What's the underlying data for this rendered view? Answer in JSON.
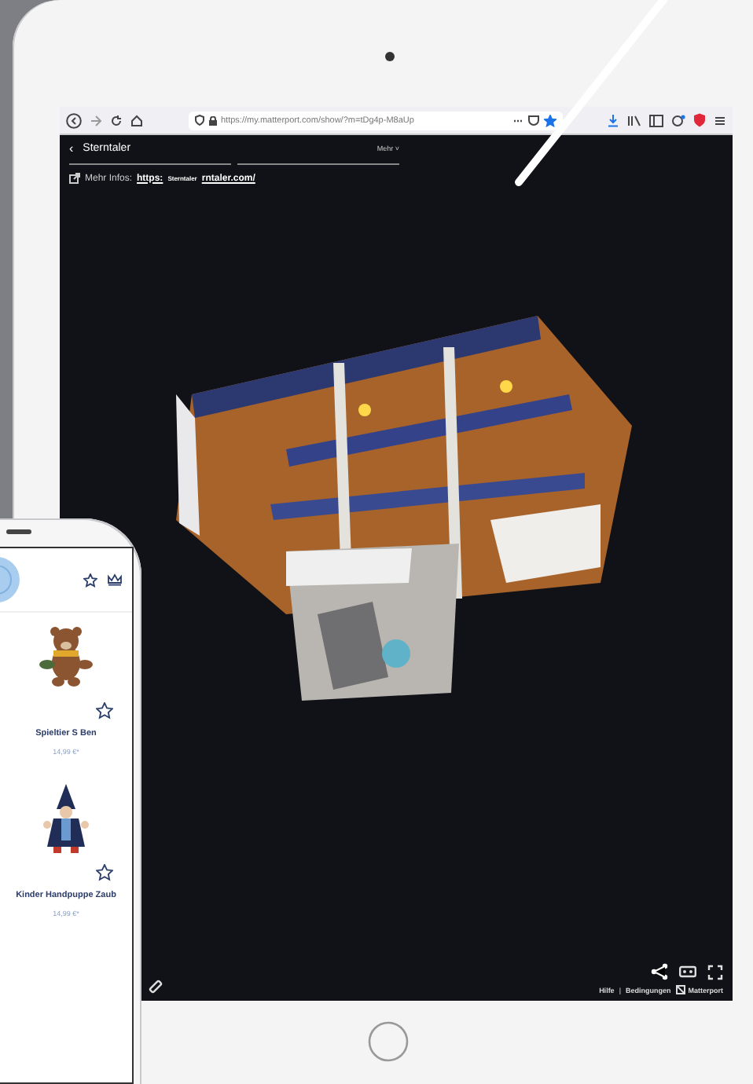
{
  "browser": {
    "url": "https://my.matterport.com/show/?m=tDg4p-M8aUp",
    "menu": "⋯",
    "bookmarked": true
  },
  "tour": {
    "title": "Sterntaler",
    "back": "‹",
    "more": "Mehr ˅",
    "info_label": "Mehr Infos:",
    "link_parts": [
      "https:",
      "Sterntaler",
      "rntaler.com/"
    ]
  },
  "footer": {
    "links": [
      "Hilfe",
      "|",
      "Bedingungen"
    ],
    "brand": "Matterport"
  },
  "phone": {
    "products": [
      {
        "name": "Spieltier S Ben",
        "price": "14,99 €*",
        "kind": "bear"
      },
      {
        "name": "Kinder Handpuppe Zaub",
        "price": "14,99 €*",
        "kind": "wizard"
      }
    ]
  }
}
